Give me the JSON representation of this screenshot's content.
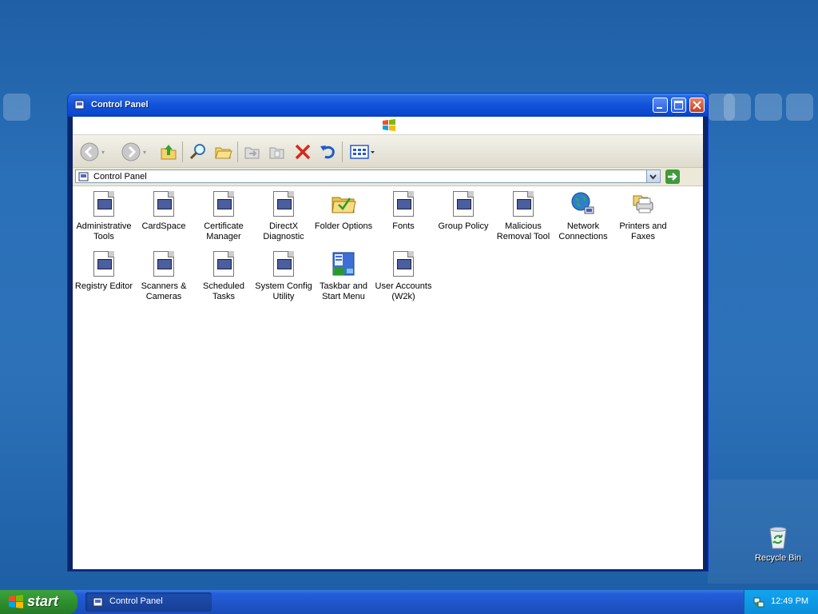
{
  "window": {
    "title": "Control Panel"
  },
  "address": {
    "value": "Control Panel"
  },
  "items": [
    {
      "label": "Administrative Tools",
      "icon": "document-app-icon"
    },
    {
      "label": "CardSpace",
      "icon": "document-app-icon"
    },
    {
      "label": "Certificate Manager",
      "icon": "document-app-icon"
    },
    {
      "label": "DirectX Diagnostic",
      "icon": "document-app-icon"
    },
    {
      "label": "Folder Options",
      "icon": "folder-options-icon"
    },
    {
      "label": "Fonts",
      "icon": "document-app-icon"
    },
    {
      "label": "Group Policy",
      "icon": "document-app-icon"
    },
    {
      "label": "Malicious Removal Tool",
      "icon": "document-app-icon"
    },
    {
      "label": "Network Connections",
      "icon": "network-connections-icon"
    },
    {
      "label": "Printers and Faxes",
      "icon": "printer-icon"
    },
    {
      "label": "Registry Editor",
      "icon": "document-app-icon"
    },
    {
      "label": "Scanners & Cameras",
      "icon": "document-app-icon"
    },
    {
      "label": "Scheduled Tasks",
      "icon": "document-app-icon"
    },
    {
      "label": "System Config Utility",
      "icon": "document-app-icon"
    },
    {
      "label": "Taskbar and Start Menu",
      "icon": "taskbar-icon"
    },
    {
      "label": "User Accounts (W2k)",
      "icon": "document-app-icon"
    }
  ],
  "taskbar": {
    "start_label": "start",
    "task_label": "Control Panel",
    "clock": "12:49 PM"
  },
  "desktop": {
    "recycle_label": "Recycle Bin"
  },
  "colors": {
    "title_blue": "#0a4ad0",
    "start_green": "#2b8c2b",
    "desktop_blue": "#2a70b8"
  }
}
